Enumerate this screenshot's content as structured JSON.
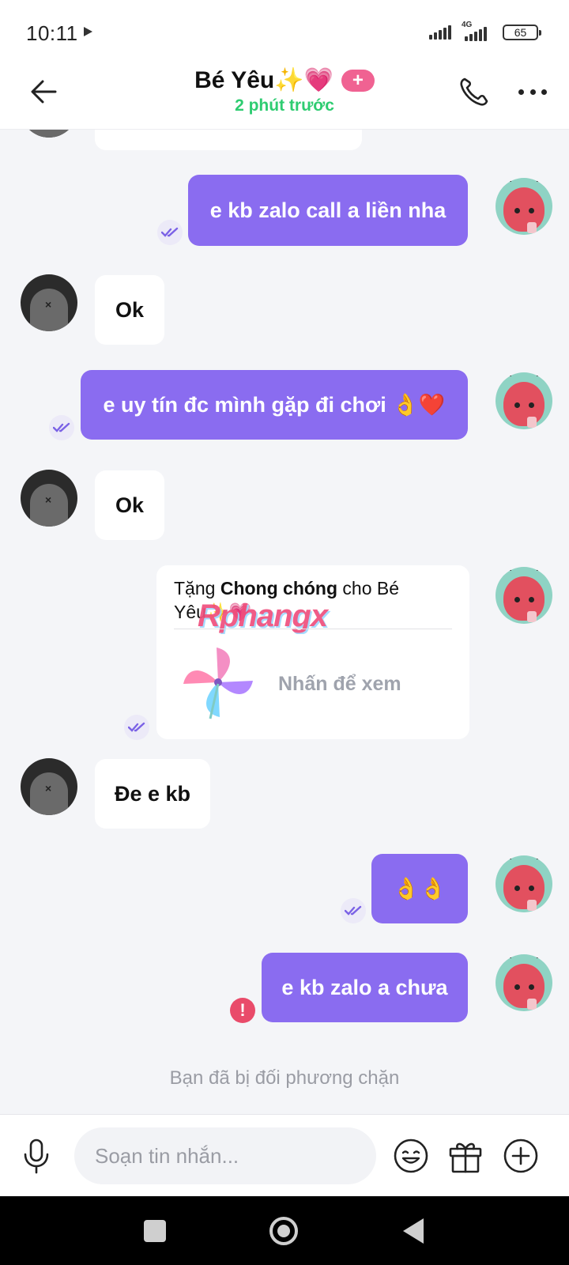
{
  "status_bar": {
    "time": "10:11",
    "network_label": "4G",
    "battery": "65"
  },
  "header": {
    "contact_name": "Bé Yêu✨💗",
    "plus_badge": "+",
    "last_seen": "2 phút trước"
  },
  "messages": [
    {
      "direction": "out",
      "text": "e kb zalo call a liền nha",
      "status": "seen"
    },
    {
      "direction": "in",
      "text": "Ok"
    },
    {
      "direction": "out",
      "text": "e uy tín đc mình gặp đi chơi 👌❤️",
      "status": "seen"
    },
    {
      "direction": "in",
      "text": "Ok"
    },
    {
      "direction": "out",
      "type": "gift",
      "prefix": "Tặng",
      "gift_name": "Chong chóng",
      "connector": "cho",
      "recipient": "Bé Yêu✨💗",
      "cta": "Nhấn để xem",
      "status": "seen"
    },
    {
      "direction": "in",
      "text": "Đe e kb"
    },
    {
      "direction": "out",
      "text": "👌👌",
      "status": "seen"
    },
    {
      "direction": "out",
      "text": "e kb zalo a chưa",
      "status": "error"
    }
  ],
  "watermark": "Rphangx",
  "blocked_notice": "Bạn đã bị đối phương chặn",
  "composer": {
    "placeholder": "Soạn tin nhắn..."
  },
  "icons": {
    "back": "arrow-left-icon",
    "call": "phone-icon",
    "more": "more-dots-icon",
    "mic": "microphone-icon",
    "emoji": "smiley-icon",
    "gift": "gift-icon",
    "add": "plus-circle-icon",
    "seen": "double-check-icon",
    "error": "exclamation-icon"
  },
  "colors": {
    "outgoing_bubble": "#8a6cf0",
    "incoming_bubble": "#ffffff",
    "online_green": "#2ecc71",
    "error_red": "#e94b6a",
    "plus_badge": "#f06292"
  }
}
